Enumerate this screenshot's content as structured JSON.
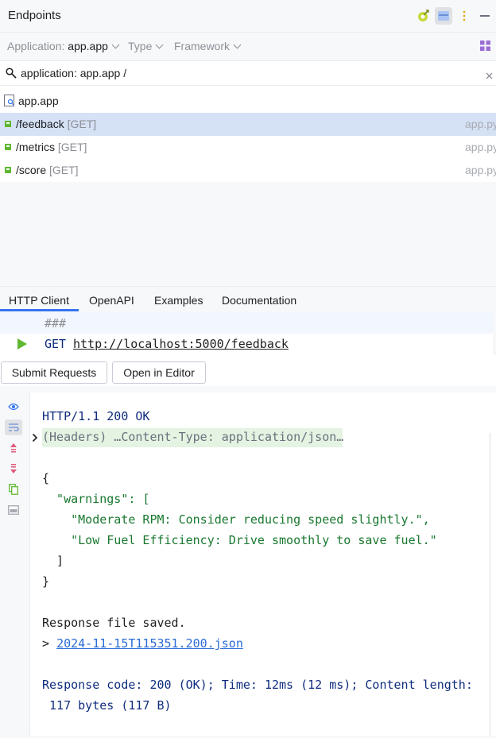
{
  "header": {
    "title": "Endpoints",
    "icons": [
      "target-icon",
      "layout-toggle-icon",
      "more-options-icon",
      "minimize-icon"
    ]
  },
  "filters": {
    "application_label": "Application:",
    "application_value": "app.app",
    "type_label": "Type",
    "framework_label": "Framework",
    "grid_icon": "grid-view-icon"
  },
  "search": {
    "icon": "search-icon",
    "value": "application: app.app /",
    "clear_icon": "close-icon"
  },
  "endpoints": {
    "app_name": "app.app",
    "items": [
      {
        "path": "/feedback",
        "method": "[GET]",
        "file": "app.py"
      },
      {
        "path": "/metrics",
        "method": "[GET]",
        "file": "app.py"
      },
      {
        "path": "/score",
        "method": "[GET]",
        "file": "app.py"
      }
    ]
  },
  "tabs": [
    "HTTP Client",
    "OpenAPI",
    "Examples",
    "Documentation"
  ],
  "request": {
    "separator": "###",
    "method": "GET",
    "url": "http://localhost:5000/feedback"
  },
  "buttons": {
    "submit": "Submit Requests",
    "open_editor": "Open in Editor"
  },
  "response": {
    "status": "HTTP/1.1 200 OK",
    "headers": "(Headers) …Content-Type: application/json…",
    "brace_open": "{",
    "key_line": "  \"warnings\": [",
    "warning_1": "    \"Moderate RPM: Consider reducing speed slightly.\",",
    "warning_2": "    \"Low Fuel Efficiency: Drive smoothly to save fuel.\"",
    "bracket_close": "  ]",
    "brace_close": "}",
    "saved": "Response file saved.",
    "file_prefix": "> ",
    "file_link": "2024-11-15T115351.200.json",
    "summary_1": "Response code: 200 (OK); Time: 12ms (12 ms); Content length:",
    "summary_2": " 117 bytes (117 B)"
  },
  "colors": {
    "accent": "#3574f0",
    "selection": "#d5e1f5",
    "json_string": "#19782f",
    "navy_text": "#0f2d7e",
    "run_green": "#5fb832"
  }
}
